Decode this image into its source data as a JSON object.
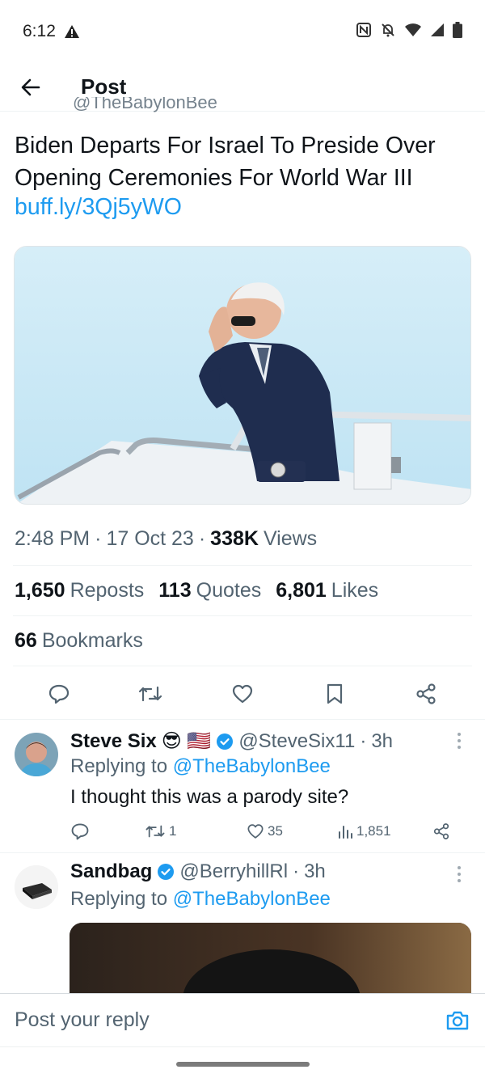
{
  "status_bar": {
    "time": "6:12",
    "icons": [
      "warning-icon",
      "nfc-icon",
      "mute-bell-icon",
      "wifi-icon",
      "signal-icon",
      "battery-icon"
    ]
  },
  "header": {
    "back_icon": "arrow-left-icon",
    "title": "Post"
  },
  "tweet": {
    "clipped_handle": "@TheBabylonBee",
    "text": "Biden Departs For Israel To Preside Over Opening Ceremonies For World War III",
    "link": "buff.ly/3Qj5yWO",
    "time": "2:48 PM",
    "date": "17 Oct 23",
    "views_count": "338K",
    "views_label": "Views",
    "reposts_count": "1,650",
    "reposts_label": "Reposts",
    "quotes_count": "113",
    "quotes_label": "Quotes",
    "likes_count": "6,801",
    "likes_label": "Likes",
    "bookmarks_count": "66",
    "bookmarks_label": "Bookmarks"
  },
  "actions": [
    "reply-icon",
    "repost-icon",
    "like-icon",
    "bookmark-icon",
    "share-icon"
  ],
  "replies": [
    {
      "name": "Steve Six",
      "emoji": "😎 🇺🇸",
      "handle": "@SteveSix11",
      "time": "3h",
      "replying_label": "Replying to",
      "replying_to": "@TheBabylonBee",
      "text": "I thought this was a parody site?",
      "reposts": "1",
      "likes": "35",
      "views": "1,851"
    },
    {
      "name": "Sandbag",
      "handle": "@BerryhillRl",
      "time": "3h",
      "replying_label": "Replying to",
      "replying_to": "@TheBabylonBee"
    }
  ],
  "composer": {
    "placeholder": "Post your reply"
  },
  "colors": {
    "accent": "#1d9bf0",
    "text_primary": "#0f1419",
    "text_secondary": "#536471",
    "divider": "#eff3f4"
  }
}
